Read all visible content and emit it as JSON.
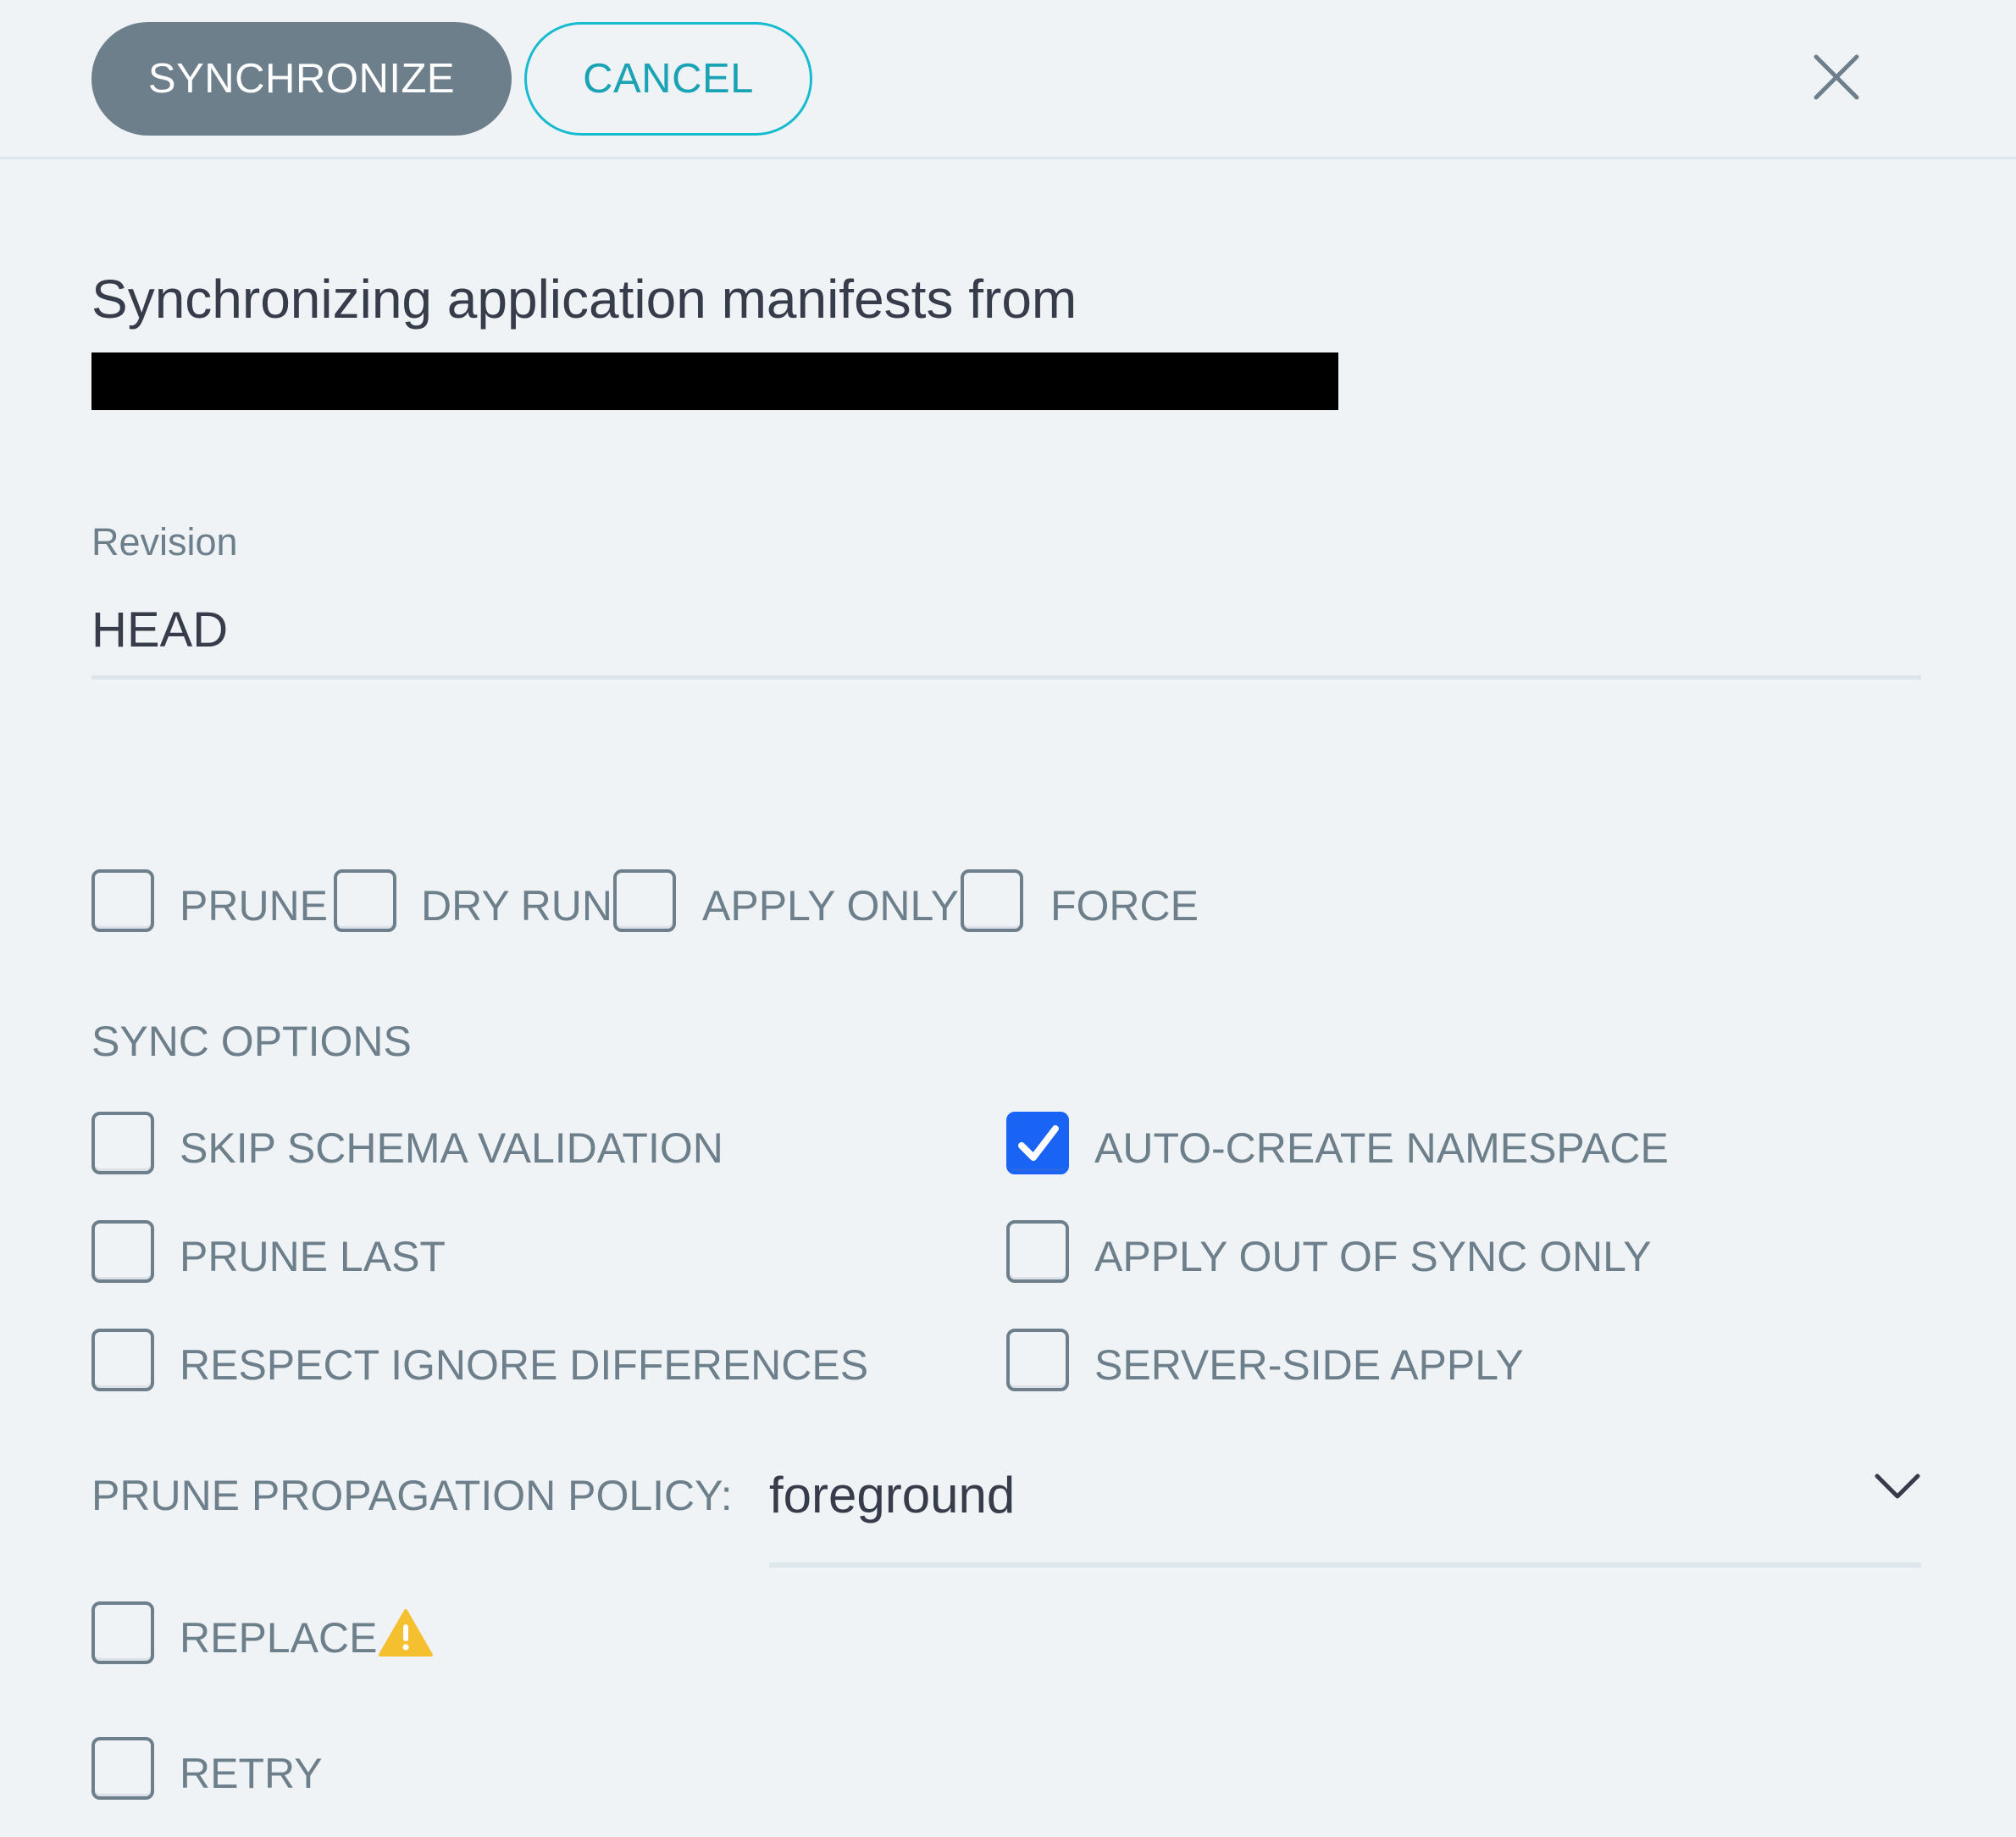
{
  "header": {
    "synchronize_label": "SYNCHRONIZE",
    "cancel_label": "CANCEL",
    "close_icon": "close-icon"
  },
  "intro_text": "Synchronizing application manifests from",
  "revision": {
    "label": "Revision",
    "value": "HEAD"
  },
  "options": {
    "prune": "PRUNE",
    "dry_run": "DRY RUN",
    "apply_only": "APPLY ONLY",
    "force": "FORCE"
  },
  "sync_options": {
    "title": "SYNC OPTIONS",
    "skip_schema_validation": "SKIP SCHEMA VALIDATION",
    "auto_create_namespace": "AUTO-CREATE NAMESPACE",
    "prune_last": "PRUNE LAST",
    "apply_out_of_sync_only": "APPLY OUT OF SYNC ONLY",
    "respect_ignore_differences": "RESPECT IGNORE DIFFERENCES",
    "server_side_apply": "SERVER-SIDE APPLY",
    "auto_create_namespace_checked": true
  },
  "prune_propagation": {
    "label": "PRUNE PROPAGATION POLICY:",
    "value": "foreground"
  },
  "replace_label": "REPLACE",
  "retry_label": "RETRY",
  "colors": {
    "accent": "#1aa2b5",
    "primary_button": "#6d7f8b",
    "checkbox_checked": "#1a64f5",
    "warning": "#f4c030",
    "background": "#eff3f6"
  }
}
